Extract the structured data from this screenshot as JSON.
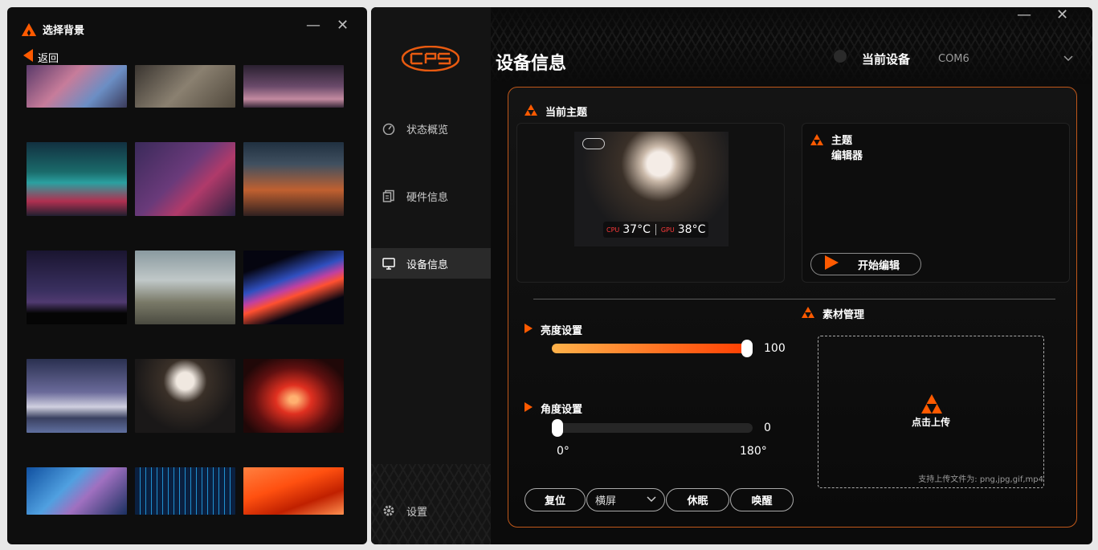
{
  "left_window": {
    "title": "选择背景",
    "minimize": "—",
    "close": "✕",
    "back_label": "返回",
    "thumbnails": [
      {
        "name": "anime-girl-city"
      },
      {
        "name": "anime-girls-ruins"
      },
      {
        "name": "rainy-street"
      },
      {
        "name": "neon-city"
      },
      {
        "name": "cyber-girl"
      },
      {
        "name": "sci-fi-city"
      },
      {
        "name": "night-forest"
      },
      {
        "name": "misty-mountain"
      },
      {
        "name": "light-wave"
      },
      {
        "name": "snow-volcano"
      },
      {
        "name": "white-hair-girl"
      },
      {
        "name": "red-flare"
      },
      {
        "name": "blue-glass"
      },
      {
        "name": "digital-grid"
      },
      {
        "name": "orange-waves"
      }
    ]
  },
  "right_window": {
    "minimize": "—",
    "close": "✕",
    "sidebar": {
      "items": [
        {
          "label": "状态概览",
          "icon": "gauge-icon"
        },
        {
          "label": "硬件信息",
          "icon": "document-icon"
        },
        {
          "label": "设备信息",
          "icon": "monitor-icon",
          "active": true
        },
        {
          "label": "设置",
          "icon": "gear-icon"
        }
      ]
    },
    "header": {
      "title": "设备信息",
      "current_device_label": "当前设备",
      "device_value": "COM6"
    },
    "theme": {
      "section_title": "当前主题",
      "preview": {
        "cpu_label": "CPU",
        "cpu_temp": "37°C",
        "gpu_label": "GPU",
        "gpu_temp": "38°C"
      },
      "editor_title_line1": "主题",
      "editor_title_line2": "编辑器",
      "start_edit_label": "开始编辑"
    },
    "materials": {
      "section_title": "素材管理",
      "upload_label": "点击上传",
      "upload_hint": "支持上传文件为: png,jpg,gif,mp4"
    },
    "brightness": {
      "label": "亮度设置",
      "value": 100,
      "max": 100,
      "value_text": "100"
    },
    "angle": {
      "label": "角度设置",
      "value": 0,
      "max": 180,
      "value_text": "0",
      "min_label": "0°",
      "max_label": "180°"
    },
    "buttons": {
      "reset": "复位",
      "orientation": "横屏",
      "sleep": "休眠",
      "wake": "唤醒"
    }
  },
  "colors": {
    "accent": "#ff5a00",
    "card_border": "#c0581a",
    "slider_start": "#ffb24a",
    "slider_end": "#ff3c00"
  }
}
